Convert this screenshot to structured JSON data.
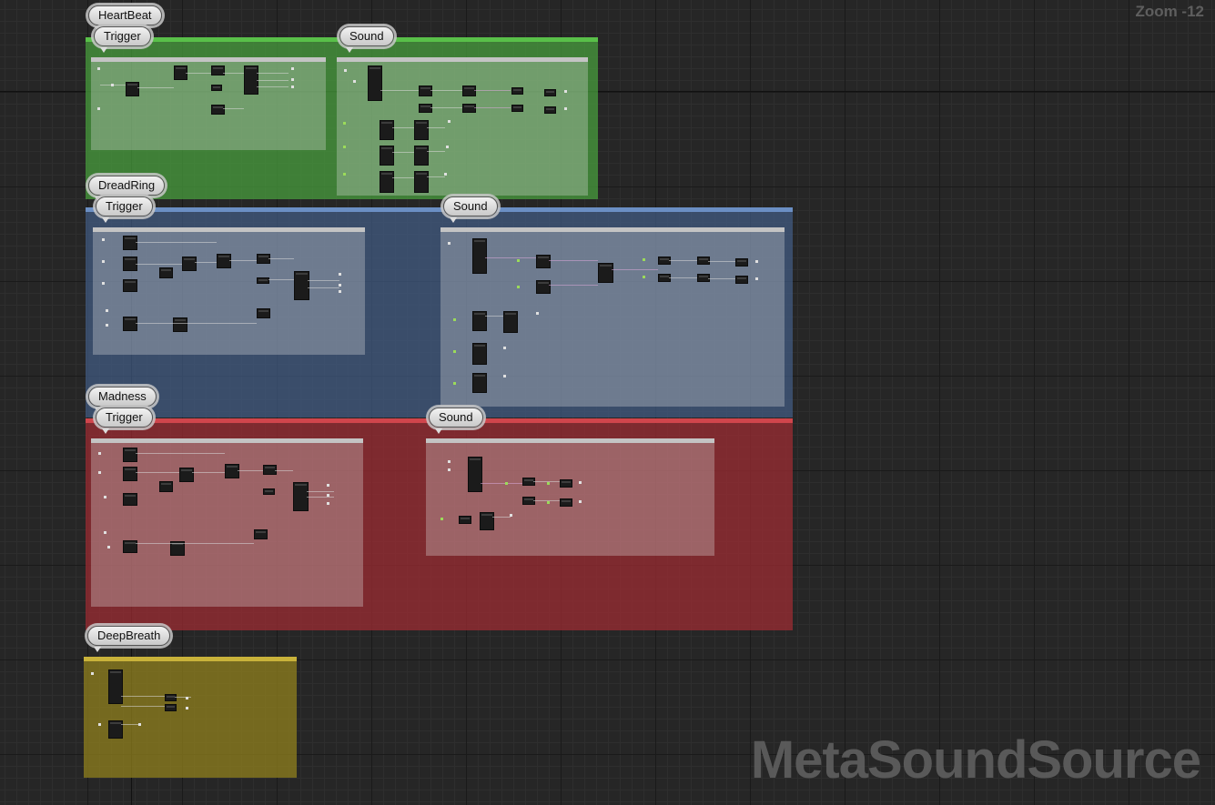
{
  "zoom": "Zoom -12",
  "watermark": "MetaSoundSource",
  "groups": [
    {
      "title": "HeartBeat",
      "color": "#5fa34f",
      "trigger": "Trigger",
      "sound": "Sound"
    },
    {
      "title": "DreadRing",
      "color": "#5b79a7",
      "trigger": "Trigger",
      "sound": "Sound"
    },
    {
      "title": "Madness",
      "color": "#b24146",
      "trigger": "Trigger",
      "sound": "Sound"
    },
    {
      "title": "DeepBreath",
      "color": "#a1902c"
    }
  ]
}
